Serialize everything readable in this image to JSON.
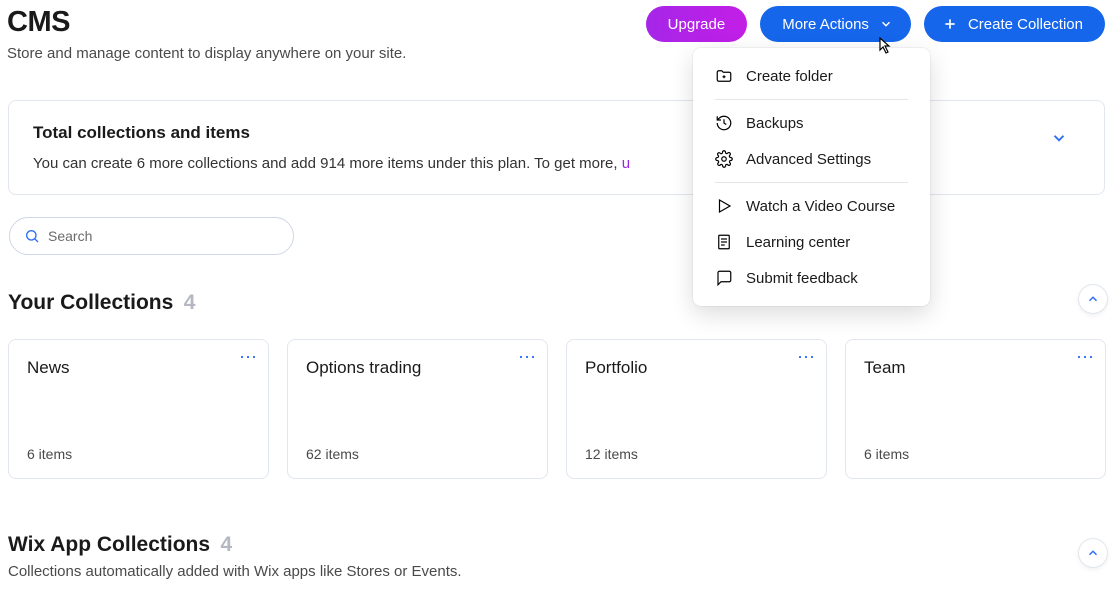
{
  "header": {
    "title": "CMS",
    "subtitle": "Store and manage content to display anywhere on your site.",
    "upgrade_label": "Upgrade",
    "more_actions_label": "More Actions",
    "create_collection_label": "Create Collection"
  },
  "dropdown": {
    "items": [
      "Create folder",
      "Backups",
      "Advanced Settings",
      "Watch a Video Course",
      "Learning center",
      "Submit feedback"
    ]
  },
  "banner": {
    "title": "Total collections and items",
    "text": "You can create 6 more collections and add 914 more items under this plan. To get more, ",
    "link_prefix": "u"
  },
  "search": {
    "placeholder": "Search"
  },
  "your_collections": {
    "heading": "Your Collections",
    "count": "4",
    "cards": [
      {
        "title": "News",
        "items": "6 items"
      },
      {
        "title": "Options trading",
        "items": "62 items"
      },
      {
        "title": "Portfolio",
        "items": "12 items"
      },
      {
        "title": "Team",
        "items": "6 items"
      }
    ]
  },
  "app_collections": {
    "heading": "Wix App Collections",
    "count": "4",
    "sub": "Collections automatically added with Wix apps like Stores or Events."
  }
}
